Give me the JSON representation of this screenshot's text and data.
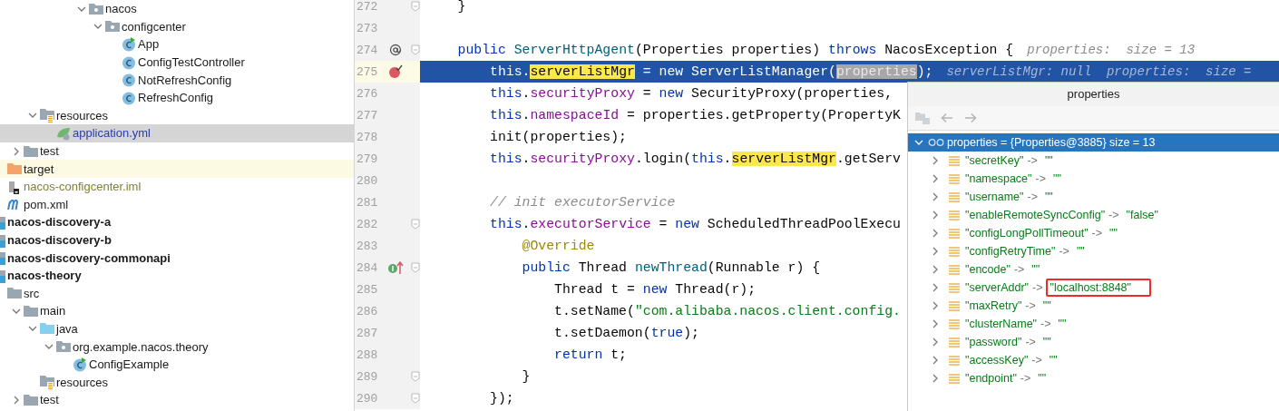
{
  "project_tree": [
    {
      "children": [
        {
          "children": [
            {
              "children": [
                {
                  "children": [
                    {
                      "children": [
                        {
                          "children": [
                            {
                              "label": "nacos",
                              "kind": "package",
                              "expanded": true,
                              "selected": false,
                              "children": [
                                {
                                  "label": "configcenter",
                                  "kind": "package",
                                  "expanded": true,
                                  "selected": false,
                                  "children": [
                                    {
                                      "label": "App",
                                      "kind": "class-run",
                                      "selected": false
                                    },
                                    {
                                      "label": "ConfigTestController",
                                      "kind": "class",
                                      "selected": false
                                    },
                                    {
                                      "label": "NotRefreshConfig",
                                      "kind": "class",
                                      "selected": false
                                    },
                                    {
                                      "label": "RefreshConfig",
                                      "kind": "class",
                                      "selected": false
                                    }
                                  ]
                                }
                              ]
                            }
                          ]
                        }
                      ]
                    }
                  ]
                },
                {
                  "label": "resources",
                  "kind": "resources",
                  "expanded": true,
                  "selected": false,
                  "children": [
                    {
                      "label": "application.yml",
                      "kind": "yml",
                      "selected": true
                    }
                  ]
                }
              ]
            },
            {
              "label": "test",
              "kind": "folder",
              "expanded": false,
              "selected": false
            }
          ]
        },
        {
          "label": "target",
          "kind": "target",
          "selected": false
        },
        {
          "label": "nacos-configcenter.iml",
          "kind": "iml",
          "selected": false
        },
        {
          "label": "pom.xml",
          "kind": "maven",
          "selected": false
        }
      ]
    },
    {
      "label": "nacos-discovery-a",
      "kind": "module",
      "selected": false
    },
    {
      "label": "nacos-discovery-b",
      "kind": "module",
      "selected": false
    },
    {
      "label": "nacos-discovery-commonapi",
      "kind": "module",
      "selected": false
    },
    {
      "label": "nacos-theory",
      "kind": "module",
      "selected": false,
      "children": [
        {
          "label": "src",
          "kind": "folder",
          "selected": false,
          "children": [
            {
              "label": "main",
              "kind": "folder",
              "expanded": true,
              "selected": false,
              "children": [
                {
                  "label": "java",
                  "kind": "source",
                  "expanded": true,
                  "selected": false,
                  "children": [
                    {
                      "label": "org.example.nacos.theory",
                      "kind": "package",
                      "expanded": true,
                      "selected": false,
                      "children": [
                        {
                          "label": "ConfigExample",
                          "kind": "class-run",
                          "selected": false
                        }
                      ]
                    }
                  ]
                },
                {
                  "label": "resources",
                  "kind": "resources",
                  "selected": false
                }
              ]
            },
            {
              "label": "test",
              "kind": "folder",
              "expanded": false,
              "selected": false
            }
          ]
        }
      ]
    }
  ],
  "editor": {
    "lines": [
      {
        "number": "272",
        "fold": true,
        "tokens": [
          {
            "text": "    }",
            "kind": "plain"
          }
        ]
      },
      {
        "number": "273",
        "fold": false
      },
      {
        "number": "274",
        "fold": true,
        "kind": "at",
        "tokens": [
          {
            "text": "    public",
            "kind": "keyword"
          },
          {
            "text": " ServerHttpAgent",
            "kind": "method"
          },
          {
            "text": "(Properties properties) ",
            "kind": "plain"
          },
          {
            "text": "throws",
            "kind": "keyword"
          },
          {
            "text": " NacosException {",
            "kind": "plain"
          }
        ],
        "hint": "properties:  size = 13"
      },
      {
        "number": "275",
        "fold": false,
        "current": true,
        "kind": "breakpoint",
        "tokens": [
          {
            "text": "        this",
            "kind": "keyword"
          },
          {
            "text": ".",
            "kind": "plain"
          },
          {
            "text": "serverListMgr",
            "kind": "usage"
          },
          {
            "text": " = new ServerListManager(",
            "kind": "plain"
          },
          {
            "text": "properties",
            "kind": "evaluated"
          },
          {
            "text": ");",
            "kind": "plain"
          }
        ],
        "hint": "serverListMgr: null  properties:  size ="
      },
      {
        "number": "276",
        "fold": false,
        "tokens": [
          {
            "text": "        this",
            "kind": "keyword"
          },
          {
            "text": ".",
            "kind": "plain"
          },
          {
            "text": "securityProxy",
            "kind": "field"
          },
          {
            "text": " = ",
            "kind": "plain"
          },
          {
            "text": "new",
            "kind": "keyword"
          },
          {
            "text": " SecurityProxy(properties,",
            "kind": "plain"
          }
        ]
      },
      {
        "number": "277",
        "fold": false,
        "tokens": [
          {
            "text": "        this",
            "kind": "keyword"
          },
          {
            "text": ".",
            "kind": "plain"
          },
          {
            "text": "namespaceId",
            "kind": "field"
          },
          {
            "text": " = properties.getProperty(PropertyK",
            "kind": "plain"
          }
        ]
      },
      {
        "number": "278",
        "fold": false,
        "tokens": [
          {
            "text": "        init(properties);",
            "kind": "plain"
          }
        ]
      },
      {
        "number": "279",
        "fold": false,
        "tokens": [
          {
            "text": "        this",
            "kind": "keyword"
          },
          {
            "text": ".",
            "kind": "plain"
          },
          {
            "text": "securityProxy",
            "kind": "field"
          },
          {
            "text": ".login(",
            "kind": "plain"
          },
          {
            "text": "this",
            "kind": "keyword"
          },
          {
            "text": ".",
            "kind": "plain"
          },
          {
            "text": "serverListMgr",
            "kind": "usage"
          },
          {
            "text": ".getServ",
            "kind": "plain"
          }
        ]
      },
      {
        "number": "280",
        "fold": false
      },
      {
        "number": "281",
        "fold": false,
        "tokens": [
          {
            "text": "        // init executorService",
            "kind": "comment"
          }
        ]
      },
      {
        "number": "282",
        "fold": true,
        "tokens": [
          {
            "text": "        this",
            "kind": "keyword"
          },
          {
            "text": ".",
            "kind": "plain"
          },
          {
            "text": "executorService",
            "kind": "field"
          },
          {
            "text": " = ",
            "kind": "plain"
          },
          {
            "text": "new",
            "kind": "keyword"
          },
          {
            "text": " ScheduledThreadPoolExecu",
            "kind": "plain"
          }
        ]
      },
      {
        "number": "283",
        "fold": false,
        "tokens": [
          {
            "text": "            @Override",
            "kind": "annotation"
          }
        ]
      },
      {
        "number": "284",
        "fold": true,
        "kind": "implements",
        "tokens": [
          {
            "text": "            public",
            "kind": "keyword"
          },
          {
            "text": " Thread ",
            "kind": "plain"
          },
          {
            "text": "newThread",
            "kind": "method"
          },
          {
            "text": "(Runnable r) {",
            "kind": "plain"
          }
        ]
      },
      {
        "number": "285",
        "fold": false,
        "tokens": [
          {
            "text": "                Thread t = ",
            "kind": "plain"
          },
          {
            "text": "new",
            "kind": "keyword"
          },
          {
            "text": " Thread(r);",
            "kind": "plain"
          }
        ]
      },
      {
        "number": "286",
        "fold": false,
        "tokens": [
          {
            "text": "                t.setName(",
            "kind": "plain"
          },
          {
            "text": "\"com.alibaba.nacos.client.config.",
            "kind": "string"
          }
        ]
      },
      {
        "number": "287",
        "fold": false,
        "tokens": [
          {
            "text": "                t.setDaemon(",
            "kind": "plain"
          },
          {
            "text": "true",
            "kind": "keyword"
          },
          {
            "text": ");",
            "kind": "plain"
          }
        ]
      },
      {
        "number": "288",
        "fold": false,
        "tokens": [
          {
            "text": "                return",
            "kind": "keyword"
          },
          {
            "text": " t;",
            "kind": "plain"
          }
        ]
      },
      {
        "number": "289",
        "fold": true,
        "tokens": [
          {
            "text": "            }",
            "kind": "plain"
          }
        ]
      },
      {
        "number": "290",
        "fold": true,
        "tokens": [
          {
            "text": "        });",
            "kind": "plain"
          }
        ]
      }
    ]
  },
  "evaluate_popup": {
    "title": "properties",
    "toolbar": [
      {
        "kind": "jump",
        "disabled": true
      },
      {
        "kind": "back",
        "disabled": true
      },
      {
        "kind": "forward",
        "disabled": true
      }
    ],
    "root": {
      "text": "properties = {Properties@3885}  size = 13",
      "expanded": true,
      "selected": true
    },
    "entries": [
      {
        "key": "\"secretKey\"",
        "sep": "->",
        "value": "\"\"",
        "expanded": false,
        "marked": false
      },
      {
        "key": "\"namespace\"",
        "sep": "->",
        "value": "\"\"",
        "expanded": false,
        "marked": false
      },
      {
        "key": "\"username\"",
        "sep": "->",
        "value": "\"\"",
        "expanded": false,
        "marked": false
      },
      {
        "key": "\"enableRemoteSyncConfig\"",
        "sep": "->",
        "value": "\"false\"",
        "expanded": false,
        "marked": false
      },
      {
        "key": "\"configLongPollTimeout\"",
        "sep": "->",
        "value": "\"\"",
        "expanded": false,
        "marked": false
      },
      {
        "key": "\"configRetryTime\"",
        "sep": "->",
        "value": "\"\"",
        "expanded": false,
        "marked": false
      },
      {
        "key": "\"encode\"",
        "sep": "->",
        "value": "\"\"",
        "expanded": false,
        "marked": false
      },
      {
        "key": "\"serverAddr\"",
        "sep": "->",
        "value": "\"localhost:8848\"",
        "expanded": false,
        "marked": true
      },
      {
        "key": "\"maxRetry\"",
        "sep": "->",
        "value": "\"\"",
        "expanded": false,
        "marked": false
      },
      {
        "key": "\"clusterName\"",
        "sep": "->",
        "value": "\"\"",
        "expanded": false,
        "marked": false
      },
      {
        "key": "\"password\"",
        "sep": "->",
        "value": "\"\"",
        "expanded": false,
        "marked": false
      },
      {
        "key": "\"accessKey\"",
        "sep": "->",
        "value": "\"\"",
        "expanded": false,
        "marked": false
      },
      {
        "key": "\"endpoint\"",
        "sep": "->",
        "value": "\"\"",
        "expanded": false,
        "marked": false
      }
    ]
  }
}
